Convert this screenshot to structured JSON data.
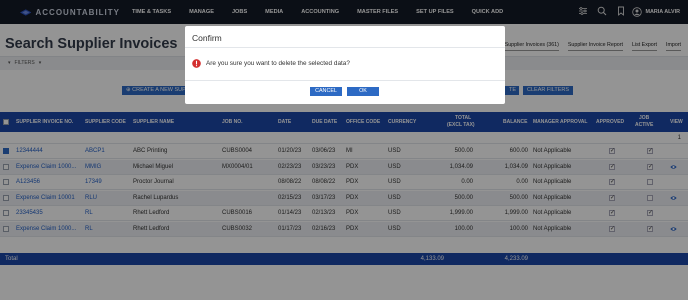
{
  "app": {
    "logo_text": "ACCOUNTABILITY"
  },
  "nav": {
    "items": [
      "TIME & TASKS",
      "MANAGE",
      "JOBS",
      "MEDIA",
      "ACCOUNTING",
      "MASTER FILES",
      "SET UP FILES",
      "QUICK ADD"
    ],
    "user_name": "MARIA ALVIR"
  },
  "page": {
    "title": "Search Supplier Invoices",
    "links": [
      "Supplier Invoices (361)",
      "Supplier Invoice Report",
      "List Export",
      "Import"
    ],
    "filters_label": "FILTERS",
    "create_button": "CREATE A NEW SUPP",
    "search_button": "TE",
    "clear_filters_button": "CLEAR FILTERS",
    "record_count": "1"
  },
  "table": {
    "headers": {
      "invoice_no": "SUPPLIER INVOICE NO.",
      "supplier_code": "SUPPLIER CODE",
      "supplier_name": "SUPPLIER NAME",
      "job_no": "JOB NO.",
      "date": "DATE",
      "due_date": "DUE DATE",
      "office_code": "OFFICE CODE",
      "currency": "CURRENCY",
      "total_line1": "TOTAL",
      "total_line2": "(EXCL TAX)",
      "balance": "BALANCE",
      "manager_approval": "MANAGER APPROVAL",
      "approved": "APPROVED",
      "job_active_line1": "JOB",
      "job_active_line2": "ACTIVE",
      "view": "VIEW"
    },
    "rows": [
      {
        "invoice_no": "12344444",
        "supplier_code": "ABCP1",
        "supplier_name": "ABC Printing",
        "job_no": "CUBS0004",
        "date": "01/20/23",
        "due_date": "03/06/23",
        "office_code": "MI",
        "currency": "USD",
        "total": "500.00",
        "balance": "600.00",
        "manager_approval": "Not Applicable",
        "checked": true
      },
      {
        "invoice_no": "Expense Claim 1000...",
        "supplier_code": "MMIG",
        "supplier_name": "Michael Miguel",
        "job_no": "MX0004/01",
        "date": "02/23/23",
        "due_date": "03/23/23",
        "office_code": "PDX",
        "currency": "USD",
        "total": "1,034.09",
        "balance": "1,034.09",
        "manager_approval": "Not Applicable",
        "checked": false
      },
      {
        "invoice_no": "A123456",
        "supplier_code": "17349",
        "supplier_name": "Proctor Journal",
        "job_no": "",
        "date": "08/08/22",
        "due_date": "08/08/22",
        "office_code": "PDX",
        "currency": "USD",
        "total": "0.00",
        "balance": "0.00",
        "manager_approval": "Not Applicable",
        "checked": false
      },
      {
        "invoice_no": "Expense Claim 10001",
        "supplier_code": "RLU",
        "supplier_name": "Rachel Lupardus",
        "job_no": "",
        "date": "02/15/23",
        "due_date": "03/17/23",
        "office_code": "PDX",
        "currency": "USD",
        "total": "500.00",
        "balance": "500.00",
        "manager_approval": "Not Applicable",
        "checked": false
      },
      {
        "invoice_no": "23345435",
        "supplier_code": "RL",
        "supplier_name": "Rhett Ledford",
        "job_no": "CUBS0016",
        "date": "01/14/23",
        "due_date": "02/13/23",
        "office_code": "PDX",
        "currency": "USD",
        "total": "1,999.00",
        "balance": "1,999.00",
        "manager_approval": "Not Applicable",
        "checked": false
      },
      {
        "invoice_no": "Expense Claim 1000...",
        "supplier_code": "RL",
        "supplier_name": "Rhett Ledford",
        "job_no": "CUBS0032",
        "date": "01/17/23",
        "due_date": "02/16/23",
        "office_code": "PDX",
        "currency": "USD",
        "total": "100.00",
        "balance": "100.00",
        "manager_approval": "Not Applicable",
        "checked": false
      }
    ],
    "footer": {
      "label": "Total",
      "total": "4,133.09",
      "balance": "4,233.09"
    }
  },
  "dialog": {
    "title": "Confirm",
    "message": "Are you sure you want to delete the selected data?",
    "cancel_label": "CANCEL",
    "ok_label": "OK",
    "icon": "warning-icon"
  },
  "colors": {
    "nav_bg": "#141a26",
    "table_header_bg": "#1d47a8",
    "button_blue": "#2d6ac4",
    "link_blue": "#2460c7",
    "warning_red": "#d32f2f"
  }
}
